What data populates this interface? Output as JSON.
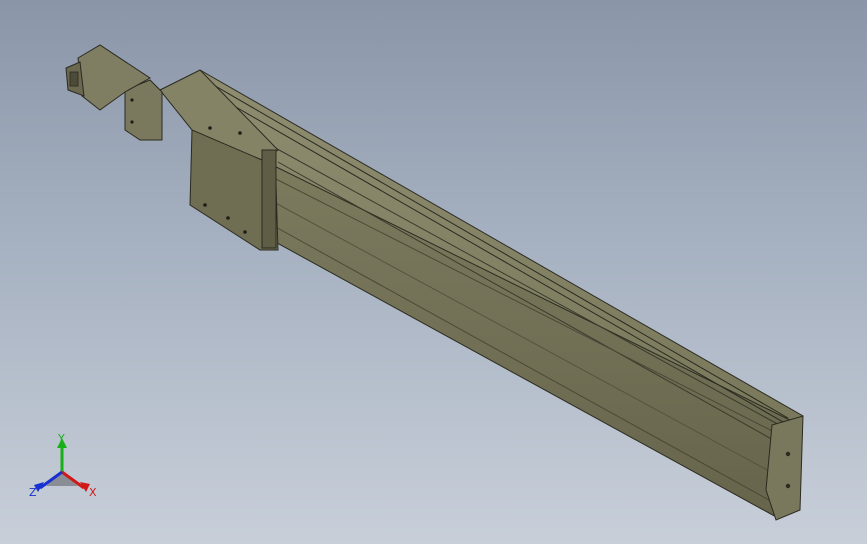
{
  "viewport": {
    "background_top": "#8a96a8",
    "background_bottom": "#c8cfd9",
    "model_color": "#767457"
  },
  "triad": {
    "x_label": "X",
    "y_label": "Y",
    "z_label": "Z",
    "x_color": "#d01818",
    "y_color": "#18b018",
    "z_color": "#1830d0"
  }
}
